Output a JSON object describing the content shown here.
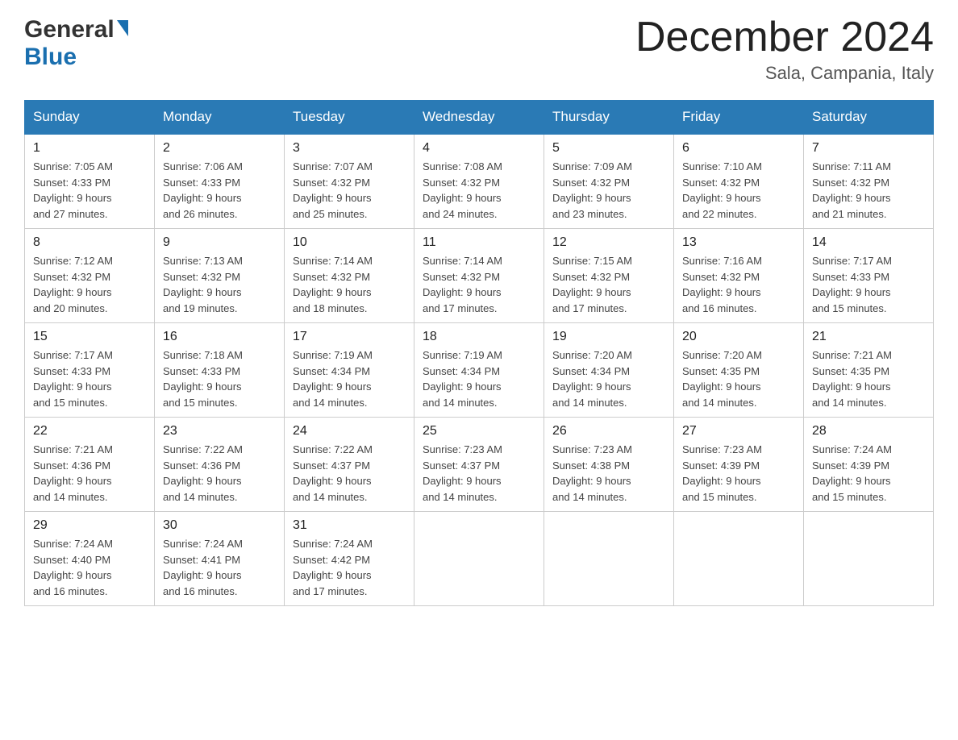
{
  "logo": {
    "general": "General",
    "blue": "Blue",
    "arrow": "▶"
  },
  "title": {
    "month_year": "December 2024",
    "location": "Sala, Campania, Italy"
  },
  "headers": [
    "Sunday",
    "Monday",
    "Tuesday",
    "Wednesday",
    "Thursday",
    "Friday",
    "Saturday"
  ],
  "weeks": [
    [
      {
        "day": "1",
        "sunrise": "7:05 AM",
        "sunset": "4:33 PM",
        "daylight": "9 hours and 27 minutes."
      },
      {
        "day": "2",
        "sunrise": "7:06 AM",
        "sunset": "4:33 PM",
        "daylight": "9 hours and 26 minutes."
      },
      {
        "day": "3",
        "sunrise": "7:07 AM",
        "sunset": "4:32 PM",
        "daylight": "9 hours and 25 minutes."
      },
      {
        "day": "4",
        "sunrise": "7:08 AM",
        "sunset": "4:32 PM",
        "daylight": "9 hours and 24 minutes."
      },
      {
        "day": "5",
        "sunrise": "7:09 AM",
        "sunset": "4:32 PM",
        "daylight": "9 hours and 23 minutes."
      },
      {
        "day": "6",
        "sunrise": "7:10 AM",
        "sunset": "4:32 PM",
        "daylight": "9 hours and 22 minutes."
      },
      {
        "day": "7",
        "sunrise": "7:11 AM",
        "sunset": "4:32 PM",
        "daylight": "9 hours and 21 minutes."
      }
    ],
    [
      {
        "day": "8",
        "sunrise": "7:12 AM",
        "sunset": "4:32 PM",
        "daylight": "9 hours and 20 minutes."
      },
      {
        "day": "9",
        "sunrise": "7:13 AM",
        "sunset": "4:32 PM",
        "daylight": "9 hours and 19 minutes."
      },
      {
        "day": "10",
        "sunrise": "7:14 AM",
        "sunset": "4:32 PM",
        "daylight": "9 hours and 18 minutes."
      },
      {
        "day": "11",
        "sunrise": "7:14 AM",
        "sunset": "4:32 PM",
        "daylight": "9 hours and 17 minutes."
      },
      {
        "day": "12",
        "sunrise": "7:15 AM",
        "sunset": "4:32 PM",
        "daylight": "9 hours and 17 minutes."
      },
      {
        "day": "13",
        "sunrise": "7:16 AM",
        "sunset": "4:32 PM",
        "daylight": "9 hours and 16 minutes."
      },
      {
        "day": "14",
        "sunrise": "7:17 AM",
        "sunset": "4:33 PM",
        "daylight": "9 hours and 15 minutes."
      }
    ],
    [
      {
        "day": "15",
        "sunrise": "7:17 AM",
        "sunset": "4:33 PM",
        "daylight": "9 hours and 15 minutes."
      },
      {
        "day": "16",
        "sunrise": "7:18 AM",
        "sunset": "4:33 PM",
        "daylight": "9 hours and 15 minutes."
      },
      {
        "day": "17",
        "sunrise": "7:19 AM",
        "sunset": "4:34 PM",
        "daylight": "9 hours and 14 minutes."
      },
      {
        "day": "18",
        "sunrise": "7:19 AM",
        "sunset": "4:34 PM",
        "daylight": "9 hours and 14 minutes."
      },
      {
        "day": "19",
        "sunrise": "7:20 AM",
        "sunset": "4:34 PM",
        "daylight": "9 hours and 14 minutes."
      },
      {
        "day": "20",
        "sunrise": "7:20 AM",
        "sunset": "4:35 PM",
        "daylight": "9 hours and 14 minutes."
      },
      {
        "day": "21",
        "sunrise": "7:21 AM",
        "sunset": "4:35 PM",
        "daylight": "9 hours and 14 minutes."
      }
    ],
    [
      {
        "day": "22",
        "sunrise": "7:21 AM",
        "sunset": "4:36 PM",
        "daylight": "9 hours and 14 minutes."
      },
      {
        "day": "23",
        "sunrise": "7:22 AM",
        "sunset": "4:36 PM",
        "daylight": "9 hours and 14 minutes."
      },
      {
        "day": "24",
        "sunrise": "7:22 AM",
        "sunset": "4:37 PM",
        "daylight": "9 hours and 14 minutes."
      },
      {
        "day": "25",
        "sunrise": "7:23 AM",
        "sunset": "4:37 PM",
        "daylight": "9 hours and 14 minutes."
      },
      {
        "day": "26",
        "sunrise": "7:23 AM",
        "sunset": "4:38 PM",
        "daylight": "9 hours and 14 minutes."
      },
      {
        "day": "27",
        "sunrise": "7:23 AM",
        "sunset": "4:39 PM",
        "daylight": "9 hours and 15 minutes."
      },
      {
        "day": "28",
        "sunrise": "7:24 AM",
        "sunset": "4:39 PM",
        "daylight": "9 hours and 15 minutes."
      }
    ],
    [
      {
        "day": "29",
        "sunrise": "7:24 AM",
        "sunset": "4:40 PM",
        "daylight": "9 hours and 16 minutes."
      },
      {
        "day": "30",
        "sunrise": "7:24 AM",
        "sunset": "4:41 PM",
        "daylight": "9 hours and 16 minutes."
      },
      {
        "day": "31",
        "sunrise": "7:24 AM",
        "sunset": "4:42 PM",
        "daylight": "9 hours and 17 minutes."
      },
      null,
      null,
      null,
      null
    ]
  ],
  "labels": {
    "sunrise_prefix": "Sunrise: ",
    "sunset_prefix": "Sunset: ",
    "daylight_prefix": "Daylight: "
  }
}
